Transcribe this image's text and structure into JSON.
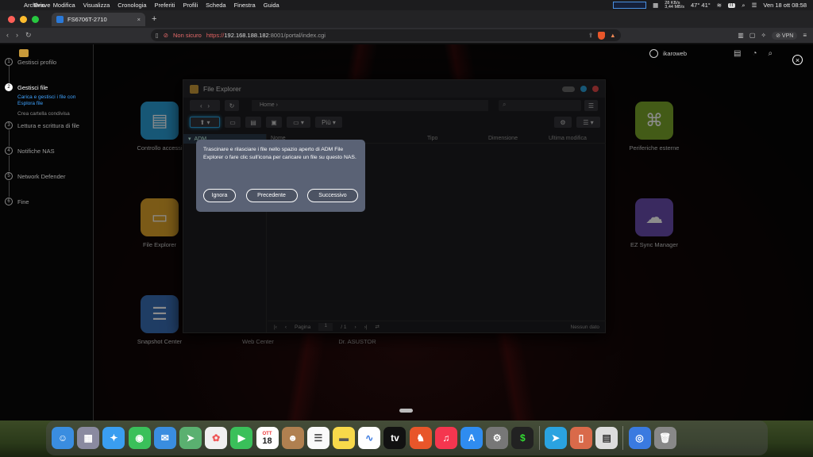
{
  "menubar": {
    "app": "Brave",
    "items": [
      "Archivio",
      "Modifica",
      "Visualizza",
      "Cronologia",
      "Preferiti",
      "Profili",
      "Scheda",
      "Finestra",
      "Guida"
    ],
    "net_up": "28 KB/s",
    "net_down": "3,44 MB/s",
    "temps": "47° 41°",
    "kb": "IT",
    "datetime": "Ven 18 ott  08:58"
  },
  "browser": {
    "tab_title": "FS6706T-2710",
    "not_secure": "Non sicuro",
    "url_scheme": "https://",
    "url_host": "192.168.188.182",
    "url_path": ":8001/portal/index.cgi",
    "vpn": "VPN"
  },
  "wizard": {
    "steps": [
      {
        "num": "1",
        "label": "Gestisci profilo"
      },
      {
        "num": "2",
        "label": "Gestisci file"
      },
      {
        "num": "3",
        "label": "Lettura e scrittura di file"
      },
      {
        "num": "4",
        "label": "Notifiche NAS"
      },
      {
        "num": "5",
        "label": "Network Defender"
      },
      {
        "num": "6",
        "label": "Fine"
      }
    ],
    "substeps": [
      "Carica e gestisci i file con Esplora file",
      "Crea cartella condivisa"
    ]
  },
  "adm": {
    "user": "ikaroweb"
  },
  "apps": {
    "controllo": "Controllo accessi",
    "file_explorer": "File Explorer",
    "snapshot": "Snapshot Center",
    "web_center": "Web Center",
    "dr_asustor": "Dr. ASUSTOR",
    "periferiche": "Periferiche esterne",
    "ez_sync": "EZ Sync Manager"
  },
  "file_explorer": {
    "title": "File Explorer",
    "breadcrumb": "Home  ›",
    "more": "Più",
    "tree_root": "ADM",
    "columns": {
      "name": "Nome",
      "type": "Tipo",
      "size": "Dimensione",
      "modified": "Ultima modifica"
    },
    "page_label": "Pagina",
    "page_value": "1",
    "page_total": "/ 1",
    "nodata": "Nessun dato"
  },
  "tooltip": {
    "text": "Trascinare e rilasciare i file nello spazio aperto di ADM File Explorer o fare clic sull'icona per caricare un file su questo NAS.",
    "ignore": "Ignora",
    "previous": "Precedente",
    "next": "Successivo"
  },
  "dock": {
    "calendar_month": "OTT",
    "calendar_day": "18"
  },
  "colors": {
    "accent": "#3fa3ff",
    "tooltip_bg": "#5a6275"
  }
}
